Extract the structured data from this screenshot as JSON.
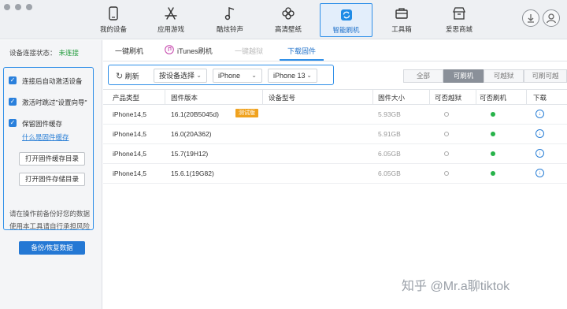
{
  "nav": {
    "items": [
      {
        "label": "我的设备",
        "icon": "phone-icon"
      },
      {
        "label": "应用游戏",
        "icon": "app-store-icon"
      },
      {
        "label": "酷炫铃声",
        "icon": "music-note-icon"
      },
      {
        "label": "高清壁纸",
        "icon": "flower-icon"
      },
      {
        "label": "智能刷机",
        "icon": "refresh-icon",
        "active": true
      },
      {
        "label": "工具箱",
        "icon": "toolbox-icon"
      },
      {
        "label": "爱思商城",
        "icon": "store-icon"
      }
    ]
  },
  "left": {
    "status_label": "设备连接状态：",
    "status_value": "未连接",
    "options": [
      "连接后自动激活设备",
      "激活时跳过\"设置向导\"",
      "保留固件缓存"
    ],
    "cache_link": "什么是固件缓存",
    "open_cache_dir": "打开固件缓存目录",
    "open_store_dir": "打开固件存储目录",
    "warning_line1": "请在操作前备份好您的数据",
    "warning_line2": "使用本工具请自行承担风险",
    "backup_button": "备份/恢复数据"
  },
  "tabs": [
    "一键刷机",
    "iTunes刷机",
    "一键越狱",
    "下载固件"
  ],
  "toolbar": {
    "refresh": "刷新",
    "device_select": "按设备选择",
    "device_type": "iPhone",
    "model": "iPhone 13",
    "filters": [
      "全部",
      "可刷机",
      "可越狱",
      "可刷可越"
    ]
  },
  "table": {
    "headers": [
      "产品类型",
      "固件版本",
      "设备型号",
      "固件大小",
      "可否越狱",
      "可否刷机",
      "下载"
    ],
    "rows": [
      {
        "product": "iPhone14,5",
        "version": "16.1(20B5045d)",
        "badge": "测试版",
        "size": "5.93GB"
      },
      {
        "product": "iPhone14,5",
        "version": "16.0(20A362)",
        "size": "5.91GB"
      },
      {
        "product": "iPhone14,5",
        "version": "15.7(19H12)",
        "size": "6.05GB"
      },
      {
        "product": "iPhone14,5",
        "version": "15.6.1(19G82)",
        "size": "6.05GB"
      }
    ]
  },
  "watermark": "知乎 @Mr.a聊tiktok",
  "colors": {
    "accent": "#2f8fe8",
    "ok": "#27b34a",
    "warn_tag": "#f0a21e"
  }
}
